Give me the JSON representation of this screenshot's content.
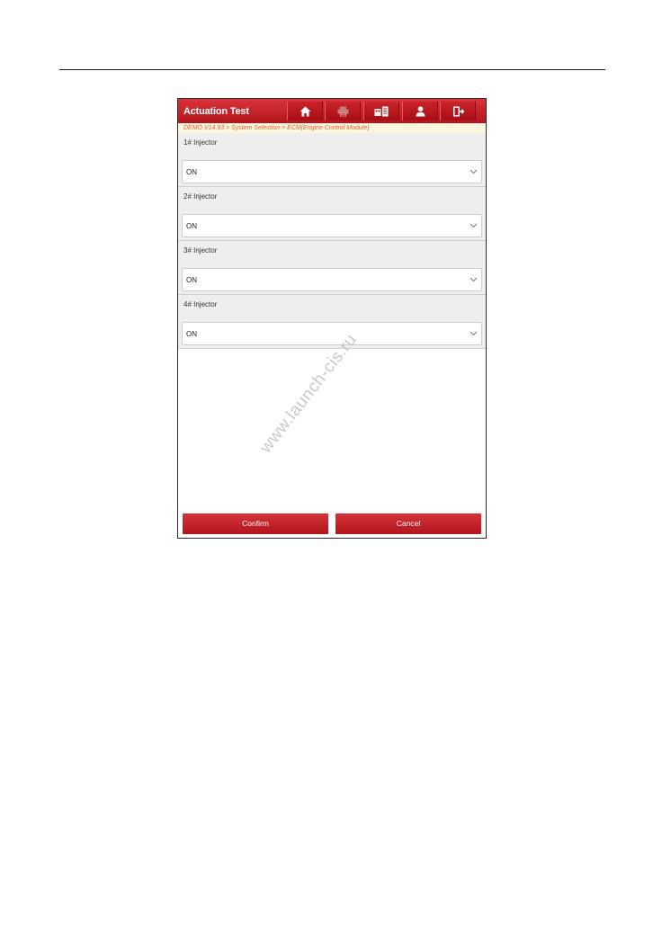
{
  "app": {
    "title": "Actuation Test",
    "breadcrumb": "DEMO V14.93 > System Selection > ECM(Engine Control Module)",
    "accent_color": "#c1151b",
    "breadcrumb_color": "#e0663a"
  },
  "toolbar": {
    "buttons": [
      {
        "icon": "home-icon"
      },
      {
        "icon": "print-icon"
      },
      {
        "icon": "vehicle-info-icon"
      },
      {
        "icon": "user-icon"
      },
      {
        "icon": "exit-icon"
      }
    ]
  },
  "injectors": [
    {
      "label": "1# Injector",
      "value": "ON"
    },
    {
      "label": "2# Injector",
      "value": "ON"
    },
    {
      "label": "3# Injector",
      "value": "ON"
    },
    {
      "label": "4# Injector",
      "value": "ON"
    }
  ],
  "actions": {
    "confirm_label": "Confirm",
    "cancel_label": "Cancel"
  },
  "watermark": "www.launch-cis.ru"
}
